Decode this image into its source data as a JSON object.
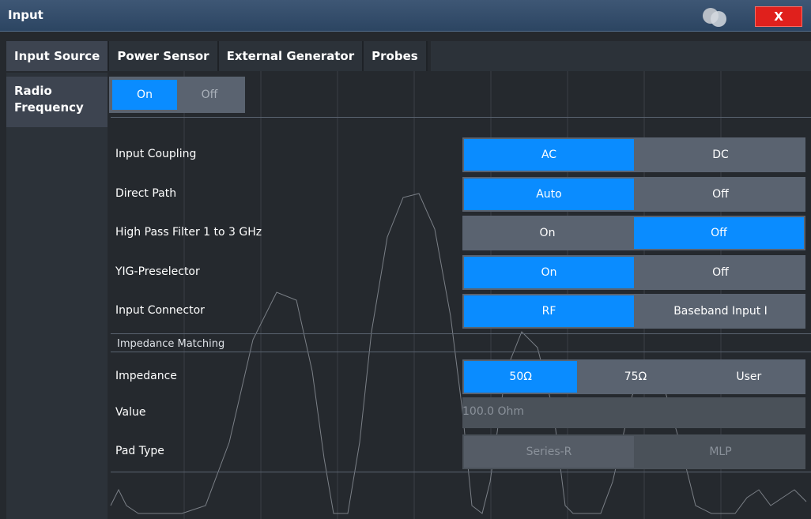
{
  "window": {
    "title": "Input",
    "close_label": "X"
  },
  "tabs": [
    {
      "label": "Input Source",
      "active": true
    },
    {
      "label": "Power Sensor",
      "active": false
    },
    {
      "label": "External Generator",
      "active": false
    },
    {
      "label": "Probes",
      "active": false
    }
  ],
  "side_tab": {
    "label_line1": "Radio",
    "label_line2": "Frequency"
  },
  "rf_toggle": {
    "on": "On",
    "off": "Off",
    "selected": "On"
  },
  "rows": {
    "input_coupling": {
      "label": "Input Coupling",
      "options": [
        "AC",
        "DC"
      ],
      "selected": "AC"
    },
    "direct_path": {
      "label": "Direct Path",
      "options": [
        "Auto",
        "Off"
      ],
      "selected": "Auto"
    },
    "high_pass": {
      "label": "High Pass Filter 1 to 3 GHz",
      "options": [
        "On",
        "Off"
      ],
      "selected": "Off"
    },
    "yig": {
      "label": "YIG-Preselector",
      "options": [
        "On",
        "Off"
      ],
      "selected": "On"
    },
    "input_connector": {
      "label": "Input Connector",
      "options": [
        "RF",
        "Baseband Input I"
      ],
      "selected": "RF"
    }
  },
  "impedance_section": {
    "title": "Impedance Matching",
    "impedance": {
      "label": "Impedance",
      "options": [
        "50Ω",
        "75Ω",
        "User"
      ],
      "selected": "50Ω"
    },
    "value": {
      "label": "Value",
      "value": "100.0 Ohm"
    },
    "pad_type": {
      "label": "Pad Type",
      "options": [
        "Series-R",
        "MLP"
      ],
      "selected": "Series-R"
    }
  },
  "colors": {
    "accent": "#0a8cff",
    "close": "#e0201c",
    "titlebar": "#34506e"
  }
}
